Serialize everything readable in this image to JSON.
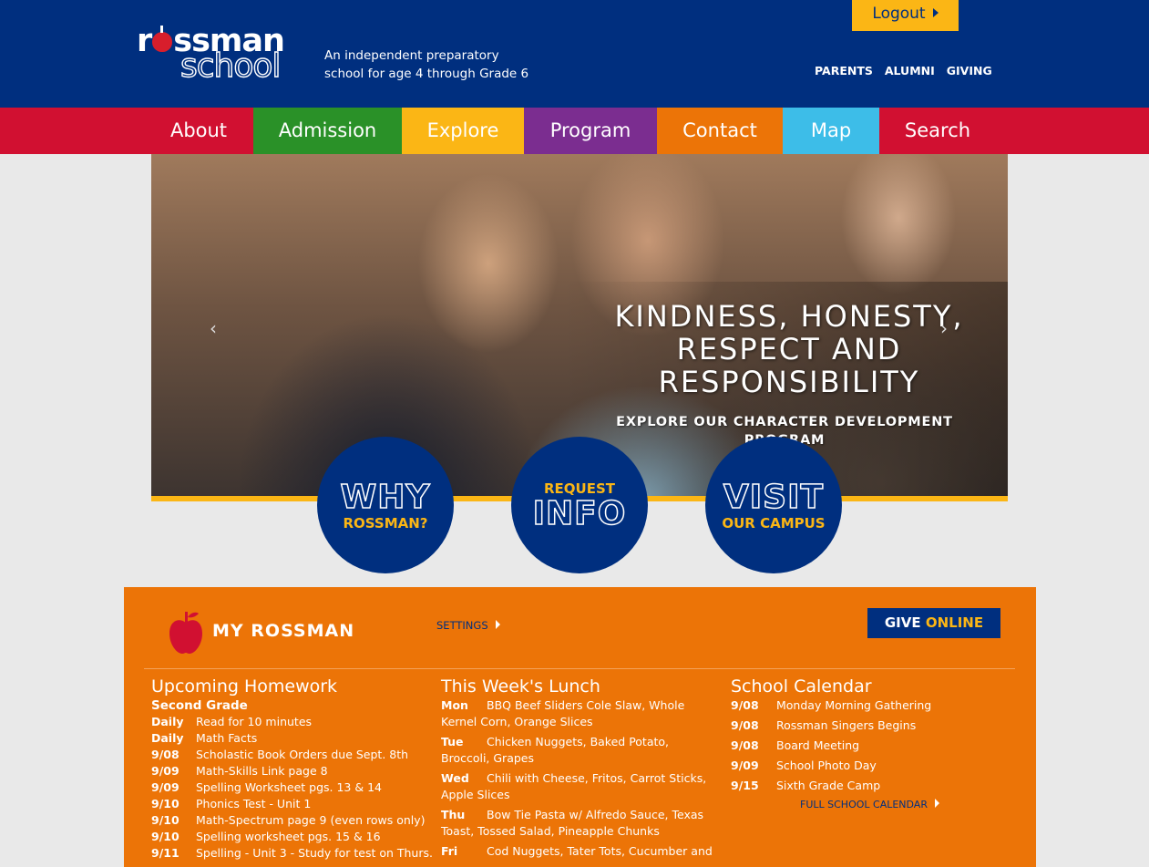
{
  "header": {
    "logo_top": "rossman",
    "logo_bottom": "school",
    "tagline_line1": "An independent preparatory",
    "tagline_line2": "school for age 4 through Grade 6",
    "logout_label": "Logout",
    "top_links": [
      "PARENTS",
      "ALUMNI",
      "GIVING"
    ],
    "colors": {
      "header_bg": "#002f7f",
      "logout_bg": "#fbb615",
      "logo_apple": "#d81e2c"
    }
  },
  "nav": {
    "items": [
      {
        "label": "About",
        "color": "#d11031"
      },
      {
        "label": "Admission",
        "color": "#2a9128"
      },
      {
        "label": "Explore",
        "color": "#fbb615"
      },
      {
        "label": "Program",
        "color": "#7b2d90"
      },
      {
        "label": "Contact",
        "color": "#ec7407"
      },
      {
        "label": "Map",
        "color": "#3dbde8"
      },
      {
        "label": "Search",
        "color": "#d11031"
      }
    ]
  },
  "hero": {
    "headline_line1": "Kindness, Honesty,",
    "headline_line2": "Respect and",
    "headline_line3": "Responsibility",
    "subline": "EXPLORE OUR CHARACTER DEVELOPMENT PROGRAM",
    "prev_icon": "chevron-left-icon",
    "next_icon": "chevron-right-icon"
  },
  "circles": [
    {
      "big": "WHY",
      "small": "ROSSMAN?"
    },
    {
      "small": "REQUEST",
      "big": "INFO"
    },
    {
      "big": "VISIT",
      "small": "OUR CAMPUS"
    }
  ],
  "my_rossman": {
    "title": "MY ROSSMAN",
    "icon": "apple-icon",
    "settings_label": "SETTINGS",
    "give_label": "GIVE",
    "give_highlight": "ONLINE",
    "homework": {
      "heading": "Upcoming Homework",
      "grade": "Second Grade",
      "rows": [
        {
          "key": "Daily",
          "text": "Read for 10 minutes"
        },
        {
          "key": "Daily",
          "text": "Math Facts"
        },
        {
          "key": "9/08",
          "text": "Scholastic Book Orders due Sept. 8th"
        },
        {
          "key": "9/09",
          "text": "Math-Skills Link page 8"
        },
        {
          "key": "9/09",
          "text": "Spelling Worksheet pgs. 13 & 14"
        },
        {
          "key": "9/10",
          "text": "Phonics Test - Unit 1"
        },
        {
          "key": "9/10",
          "text": "Math-Spectrum page 9 (even rows only)"
        },
        {
          "key": "9/10",
          "text": "Spelling worksheet pgs. 15 & 16"
        },
        {
          "key": "9/11",
          "text": "Spelling - Unit 3 - Study for test on Thurs."
        }
      ]
    },
    "lunch": {
      "heading": "This Week's Lunch",
      "rows": [
        {
          "key": "Mon",
          "text": "BBQ Beef Sliders Cole Slaw, Whole Kernel Corn, Orange Slices"
        },
        {
          "key": "Tue",
          "text": "Chicken Nuggets, Baked Potato, Broccoli, Grapes"
        },
        {
          "key": "Wed",
          "text": "Chili with Cheese, Fritos, Carrot Sticks, Apple Slices"
        },
        {
          "key": "Thu",
          "text": "Bow Tie Pasta w/ Alfredo Sauce, Texas Toast, Tossed Salad, Pineapple Chunks"
        },
        {
          "key": "Fri",
          "text": "Cod Nuggets, Tater Tots, Cucumber and"
        }
      ]
    },
    "calendar": {
      "heading": "School Calendar",
      "rows": [
        {
          "key": "9/08",
          "text": "Monday Morning Gathering"
        },
        {
          "key": "9/08",
          "text": "Rossman Singers Begins"
        },
        {
          "key": "9/08",
          "text": "Board Meeting"
        },
        {
          "key": "9/09",
          "text": "School Photo Day"
        },
        {
          "key": "9/15",
          "text": "Sixth Grade Camp"
        }
      ],
      "full_label": "FULL SCHOOL CALENDAR"
    }
  }
}
